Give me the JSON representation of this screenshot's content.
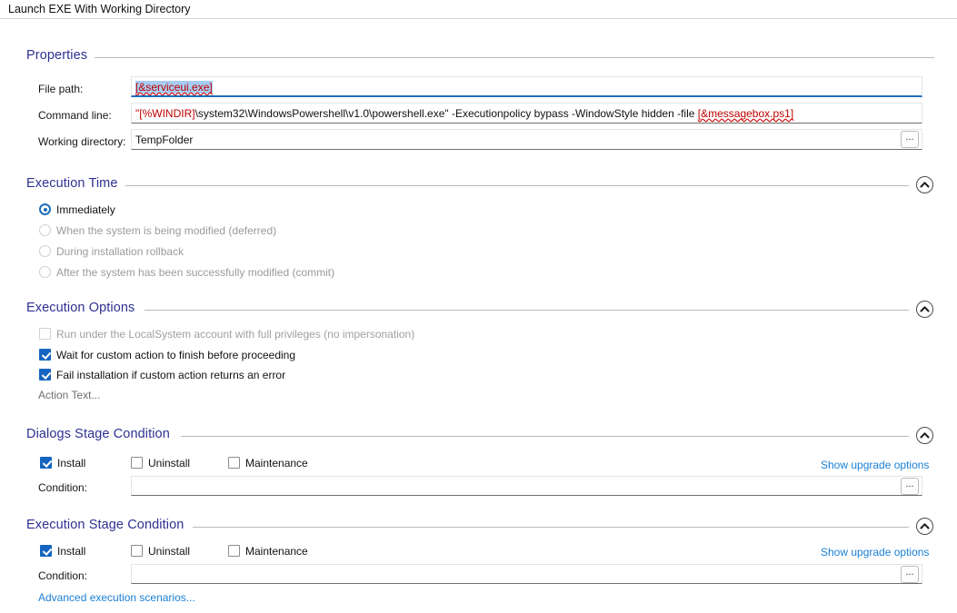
{
  "window": {
    "title": "Launch EXE With Working Directory"
  },
  "sections": {
    "properties": {
      "title": "Properties",
      "fields": {
        "file_path": {
          "label": "File path:",
          "value": "[&serviceui.exe]"
        },
        "command_line": {
          "label": "Command line:",
          "value_prefix": "\"[%WINDIR]",
          "value_mid": "\\system32\\WindowsPowershell\\v1.0\\powershell.exe\" -Executionpolicy bypass -WindowStyle hidden -file ",
          "value_token": "[&messagebox.ps1]"
        },
        "working_directory": {
          "label": "Working directory:",
          "value": "TempFolder",
          "browse_label": "..."
        }
      }
    },
    "execution_time": {
      "title": "Execution Time",
      "collapse_icon": "chevron-up-icon",
      "options": [
        {
          "label": "Immediately",
          "checked": true,
          "disabled": false
        },
        {
          "label": "When the system is being modified (deferred)",
          "checked": false,
          "disabled": true
        },
        {
          "label": "During installation rollback",
          "checked": false,
          "disabled": true
        },
        {
          "label": "After the system has been successfully modified (commit)",
          "checked": false,
          "disabled": true
        }
      ]
    },
    "execution_options": {
      "title": "Execution Options",
      "collapse_icon": "chevron-up-icon",
      "options": [
        {
          "label": "Run under the LocalSystem account with full privileges (no impersonation)",
          "checked": false,
          "disabled": true
        },
        {
          "label": "Wait for custom action to finish before proceeding",
          "checked": true,
          "disabled": false
        },
        {
          "label": "Fail installation if custom action returns an error",
          "checked": true,
          "disabled": false
        }
      ],
      "action_text": "Action Text..."
    },
    "dialogs_stage_condition": {
      "title": "Dialogs Stage Condition",
      "collapse_icon": "chevron-up-icon",
      "stages": [
        {
          "label": "Install",
          "checked": true
        },
        {
          "label": "Uninstall",
          "checked": false
        },
        {
          "label": "Maintenance",
          "checked": false
        }
      ],
      "upgrade_link": "Show upgrade options",
      "condition_label": "Condition:",
      "condition_value": "",
      "browse_label": "..."
    },
    "execution_stage_condition": {
      "title": "Execution Stage Condition",
      "collapse_icon": "chevron-up-icon",
      "stages": [
        {
          "label": "Install",
          "checked": true
        },
        {
          "label": "Uninstall",
          "checked": false
        },
        {
          "label": "Maintenance",
          "checked": false
        }
      ],
      "upgrade_link": "Show upgrade options",
      "condition_label": "Condition:",
      "condition_value": "",
      "browse_label": "...",
      "advanced_link": "Advanced execution scenarios..."
    }
  },
  "colors": {
    "section_header": "#2e3191",
    "link": "#1a7fd4",
    "accent_checkbox": "#1565c0",
    "focus_underline": "#1d6fbd",
    "token_red": "#c00000"
  }
}
